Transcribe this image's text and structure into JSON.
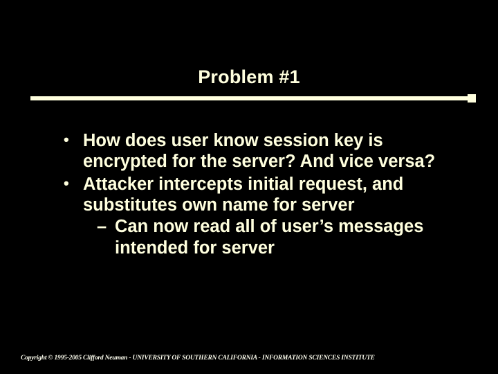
{
  "slide": {
    "title": "Problem #1",
    "bullets": [
      {
        "text": "How does user know session key is encrypted for the server?  And vice versa?"
      },
      {
        "text": "Attacker intercepts initial request, and substitutes own name for server",
        "sub": [
          {
            "text": "Can now read all of user’s messages intended for server"
          }
        ]
      }
    ],
    "footer": "Copyright © 1995-2005 Clifford Neuman - UNIVERSITY OF SOUTHERN CALIFORNIA - INFORMATION SCIENCES INSTITUTE"
  }
}
